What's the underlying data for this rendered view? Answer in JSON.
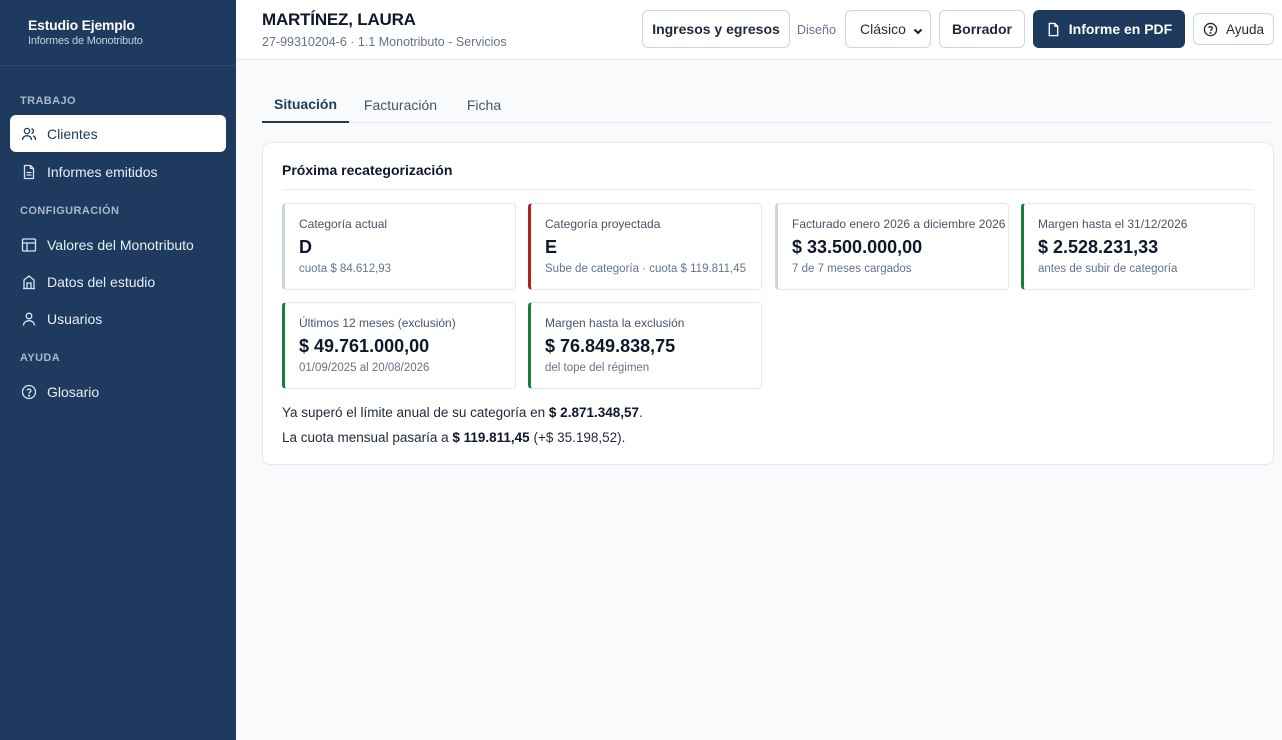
{
  "sidebar": {
    "brand": {
      "name": "Estudio Ejemplo",
      "subtitle": "Informes de Monotributo"
    },
    "sections": {
      "trabajo": "TRABAJO",
      "configuracion": "CONFIGURACIÓN",
      "ayuda": "AYUDA"
    },
    "items": {
      "clientes": {
        "label": "Clientes",
        "icon": "users-icon",
        "active": true
      },
      "informes": {
        "label": "Informes emitidos",
        "icon": "document-icon"
      },
      "valores": {
        "label": "Valores del Monotributo",
        "icon": "table-icon"
      },
      "datos": {
        "label": "Datos del estudio",
        "icon": "building-icon"
      },
      "usuarios": {
        "label": "Usuarios",
        "icon": "user-icon"
      },
      "glosario": {
        "label": "Glosario",
        "icon": "help-circle-icon"
      }
    }
  },
  "header": {
    "client_name": "MARTÍNEZ, LAURA",
    "client_meta": "27-99310204-6 · 1.1 Monotributo - Servicios",
    "ingresos_button": "Ingresos y egresos",
    "diseno_label": "Diseño",
    "diseno_selected": "Clásico",
    "borrador_button": "Borrador",
    "pdf_button": "Informe en PDF",
    "ayuda_button": "Ayuda"
  },
  "tabs": {
    "situacion": "Situación",
    "facturacion": "Facturación",
    "ficha": "Ficha"
  },
  "panel": {
    "title": "Próxima recategorización",
    "cards": {
      "actual": {
        "label": "Categoría actual",
        "value": "D",
        "sub": "cuota $ 84.612,93"
      },
      "proyectada": {
        "label": "Categoría proyectada",
        "value": "E",
        "sub": "Sube de categoría · cuota $ 119.811,45"
      },
      "facturado": {
        "label": "Facturado enero 2026 a diciembre 2026",
        "value": "$ 33.500.000,00",
        "sub": "7 de 7 meses cargados"
      },
      "margen_anual": {
        "label": "Margen hasta el 31/12/2026",
        "value": "$ 2.528.231,33",
        "sub": "antes de subir de categoría"
      },
      "ultimos": {
        "label": "Últimos 12 meses (exclusión)",
        "value": "$ 49.761.000,00",
        "sub": "01/09/2025 al 20/08/2026"
      },
      "margen_exclusion": {
        "label": "Margen hasta la exclusión",
        "value": "$ 76.849.838,75",
        "sub": "del tope del régimen"
      }
    },
    "message1": {
      "prefix": "Ya superó el límite anual de su categoría en ",
      "amount": "$ 2.871.348,57",
      "suffix": "."
    },
    "message2": {
      "prefix": "La cuota mensual pasaría a ",
      "amount": "$ 119.811,45",
      "suffix": " (+$ 35.198,52)."
    }
  },
  "colors": {
    "sidebar_bg": "#1e3a5f",
    "accent": "#1e3a5f",
    "alert_red": "#b91c1c",
    "ok_green": "#15803d"
  }
}
